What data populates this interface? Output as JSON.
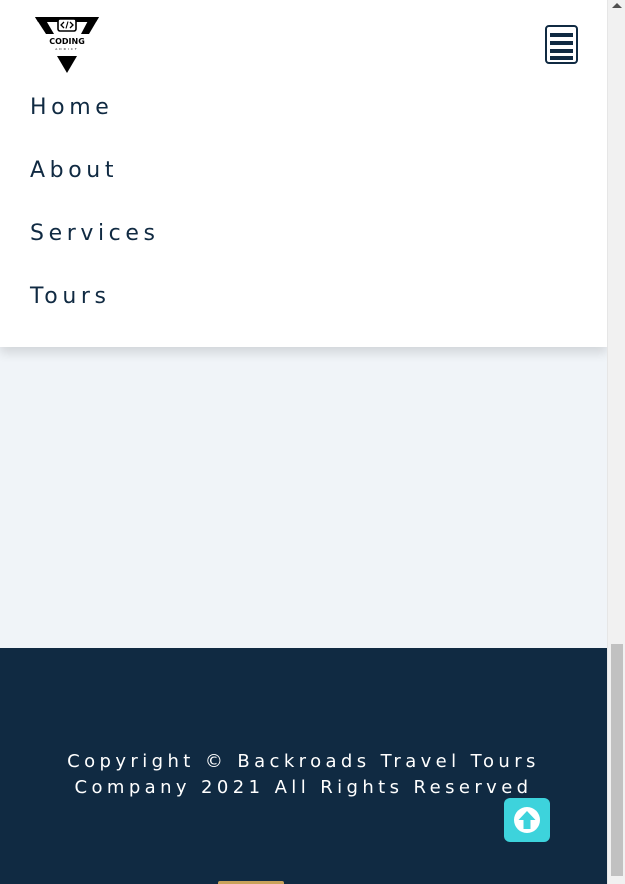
{
  "logo": {
    "name": "coding-addict-logo",
    "text": "CODING",
    "subtext": "ADDICT",
    "alt": "CODING ADDICT"
  },
  "nav": {
    "toggle_icon": "hamburger-menu-icon",
    "links": [
      {
        "label": "Home"
      },
      {
        "label": "About"
      },
      {
        "label": "Services"
      },
      {
        "label": "Tours"
      }
    ]
  },
  "footer": {
    "copyright_line1": "Copyright © Backroads Travel Tours",
    "copyright_line2": "Company 2021 All Rights Reserved"
  },
  "scroll_top": {
    "icon": "arrow-up-icon"
  },
  "colors": {
    "navy": "#102a42",
    "page_bg": "#f0f4f8",
    "accent_cyan": "#3dd3dc",
    "white": "#ffffff"
  }
}
